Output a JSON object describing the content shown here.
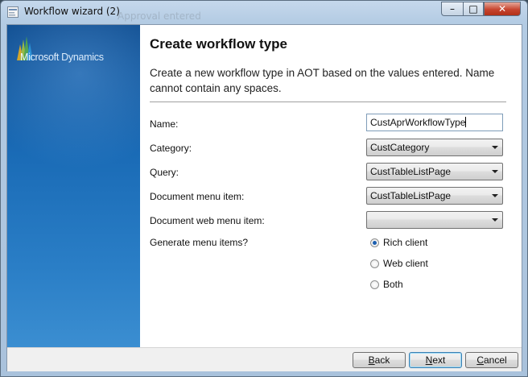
{
  "window": {
    "title": "Workflow wizard (2)",
    "ghost_text": "Approval entered",
    "controls": {
      "minimize": "–",
      "maximize": "□",
      "close": "✕"
    }
  },
  "banner": {
    "logo_text": "Microsoft Dynamics",
    "colors": [
      "#e3a50c",
      "#9bbb2a",
      "#4aa235",
      "#0f5c8f"
    ]
  },
  "page": {
    "title": "Create workflow type",
    "description": "Create a new workflow type in AOT based on the values entered. Name cannot contain any spaces."
  },
  "form": {
    "name": {
      "label": "Name:",
      "value": "CustAprWorkflowType"
    },
    "category": {
      "label": "Category:",
      "value": "CustCategory"
    },
    "query": {
      "label": "Query:",
      "value": "CustTableListPage"
    },
    "document_menu_item": {
      "label": "Document menu item:",
      "value": "CustTableListPage"
    },
    "document_web_menu_item": {
      "label": "Document web menu item:",
      "value": ""
    },
    "generate_menu_items": {
      "label": "Generate menu items?",
      "options": [
        {
          "label": "Rich client",
          "selected": true
        },
        {
          "label": "Web client",
          "selected": false
        },
        {
          "label": "Both",
          "selected": false
        }
      ]
    }
  },
  "buttons": {
    "back": {
      "prefix": "",
      "hotkey": "B",
      "rest": "ack"
    },
    "next": {
      "prefix": "",
      "hotkey": "N",
      "rest": "ext"
    },
    "cancel": {
      "prefix": "",
      "hotkey": "C",
      "rest": "ancel"
    }
  }
}
